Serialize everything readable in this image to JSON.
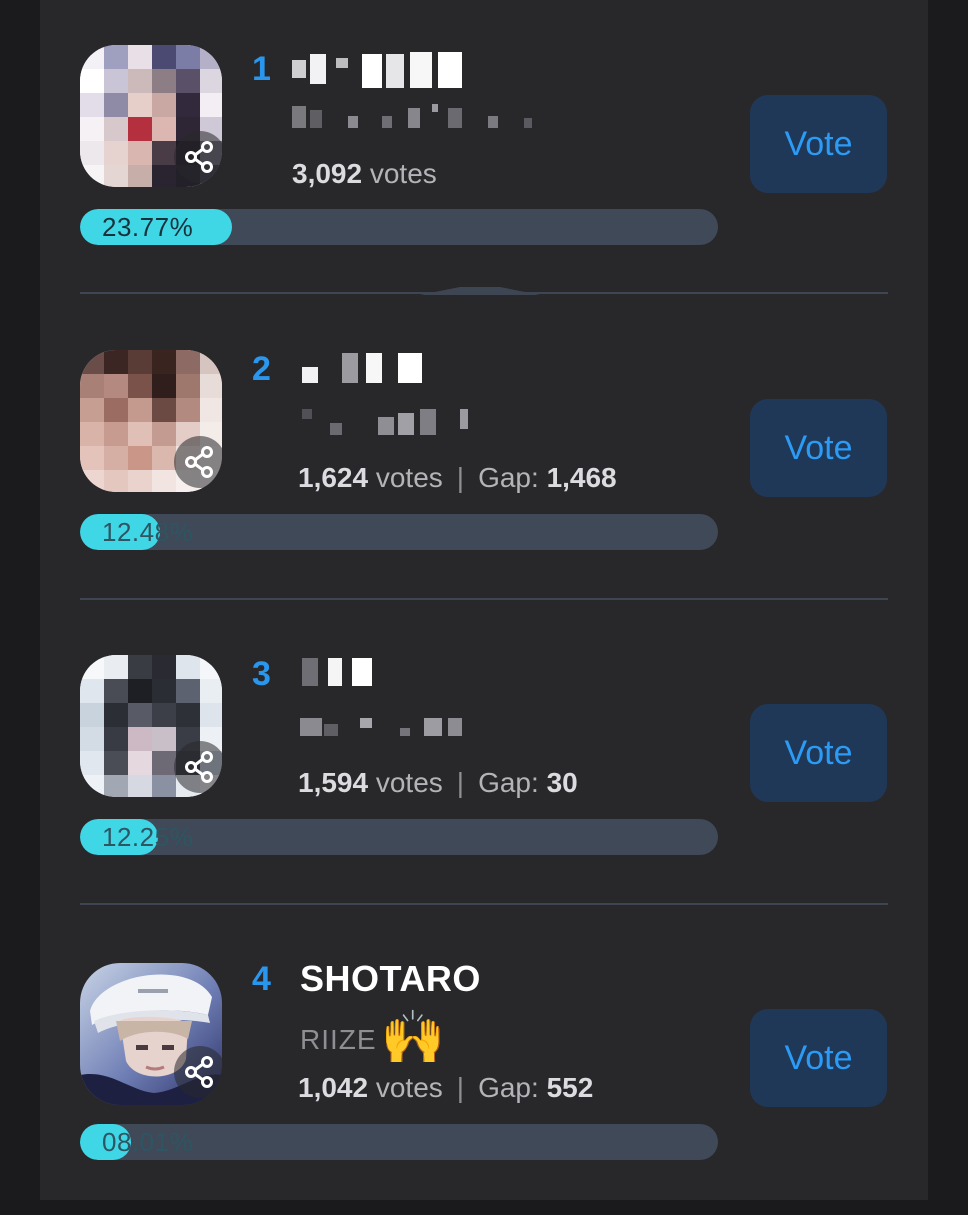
{
  "entries": [
    {
      "rank": "1",
      "name": "",
      "group": "",
      "votes": "3,092",
      "votes_suffix": "votes",
      "gap_label": "",
      "gap": "",
      "percent": "23.77%",
      "percent_value": 23.77,
      "vote_label": "Vote"
    },
    {
      "rank": "2",
      "name": "",
      "group": "",
      "votes": "1,624",
      "votes_suffix": "votes",
      "gap_label": "Gap:",
      "gap": "1,468",
      "percent": "12.48%",
      "percent_value": 12.48,
      "vote_label": "Vote"
    },
    {
      "rank": "3",
      "name": "",
      "group": "",
      "votes": "1,594",
      "votes_suffix": "votes",
      "gap_label": "Gap:",
      "gap": "30",
      "percent": "12.25%",
      "percent_value": 12.25,
      "vote_label": "Vote"
    },
    {
      "rank": "4",
      "name": "SHOTARO",
      "group": "RIIZE",
      "emoji": "🙌",
      "votes": "1,042",
      "votes_suffix": "votes",
      "gap_label": "Gap:",
      "gap": "552",
      "percent": "08.01%",
      "percent_value": 8.01,
      "vote_label": "Vote"
    }
  ],
  "colors": {
    "accent": "#2a97ef",
    "bar_fill": "#3fd7e6",
    "bar_track": "#3f4957",
    "vote_button_bg": "#1f3858"
  },
  "icons": {
    "share": "share-icon"
  }
}
